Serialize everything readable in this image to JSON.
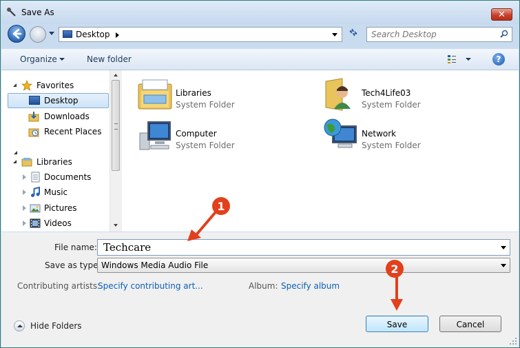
{
  "window": {
    "title": "Save As",
    "close_label": "✕"
  },
  "nav": {
    "address_location": "Desktop",
    "search_placeholder": "Search Desktop"
  },
  "toolbar": {
    "organize_label": "Organize",
    "new_folder_label": "New folder",
    "help_label": "?"
  },
  "sidebar": {
    "favorites_label": "Favorites",
    "favorites": [
      "Desktop",
      "Downloads",
      "Recent Places"
    ],
    "libraries_label": "Libraries",
    "libraries": [
      "Documents",
      "Music",
      "Pictures",
      "Videos"
    ],
    "selected": "Desktop"
  },
  "content": {
    "items": [
      {
        "name": "Libraries",
        "type": "System Folder",
        "icon": "libraries-icon"
      },
      {
        "name": "Tech4Life03",
        "type": "System Folder",
        "icon": "user-folder-icon"
      },
      {
        "name": "Computer",
        "type": "System Folder",
        "icon": "computer-icon"
      },
      {
        "name": "Network",
        "type": "System Folder",
        "icon": "network-icon"
      }
    ]
  },
  "form": {
    "file_name_label": "File name:",
    "file_name_value": "Techcare",
    "save_type_label": "Save as type:",
    "save_type_value": "Windows Media Audio File",
    "artists_label": "Contributing artists:",
    "artists_link": "Specify contributing art...",
    "album_label": "Album:",
    "album_link": "Specify album"
  },
  "footer": {
    "hide_folders_label": "Hide Folders",
    "save_label": "Save",
    "cancel_label": "Cancel"
  },
  "annotations": [
    {
      "number": "1",
      "color": "#e2401c"
    },
    {
      "number": "2",
      "color": "#e2401c"
    }
  ]
}
